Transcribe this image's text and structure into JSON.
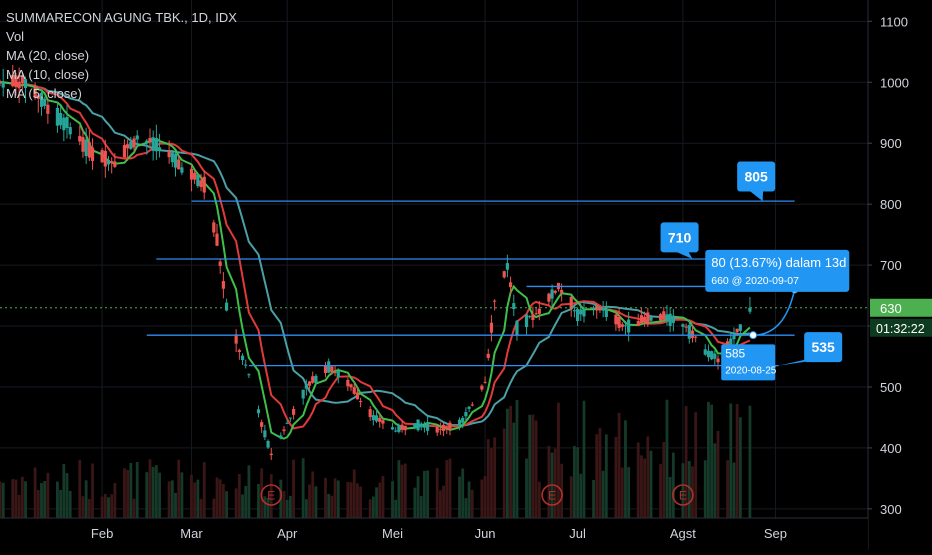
{
  "header": {
    "symbol_title": "SUMMARECON AGUNG TBK., 1D, IDX",
    "indicators": [
      "Vol",
      "MA (20, close)",
      "MA (10, close)",
      "MA (5, close)"
    ]
  },
  "colors": {
    "background": "#000000",
    "up": "#26a69a",
    "down": "#ef5350",
    "ma20": "#4b9fa6",
    "ma10": "#e03a3a",
    "ma5": "#3fbf4a",
    "hline": "#2f8cf0",
    "label_bg": "#2196f3",
    "price_line": "#4caf50",
    "earnings": "#b0302c",
    "axis_text": "#d1d4dc"
  },
  "chart_data": {
    "type": "candlestick",
    "ylim": [
      285,
      1135
    ],
    "y_ticks": [
      300,
      400,
      500,
      600,
      700,
      800,
      900,
      1000,
      1100
    ],
    "x_ticks": [
      {
        "label": "Feb",
        "date": "2020-02-03"
      },
      {
        "label": "Mar",
        "date": "2020-03-02"
      },
      {
        "label": "Apr",
        "date": "2020-04-01"
      },
      {
        "label": "Mei",
        "date": "2020-05-04"
      },
      {
        "label": "Jun",
        "date": "2020-06-02"
      },
      {
        "label": "Jul",
        "date": "2020-07-01"
      },
      {
        "label": "Agst",
        "date": "2020-08-03"
      },
      {
        "label": "Sep",
        "date": "2020-09-01"
      }
    ],
    "x_range": [
      "2020-01-02",
      "2020-09-30"
    ],
    "ohlc_anchors": [
      {
        "date": "2020-01-02",
        "close": 1000
      },
      {
        "date": "2020-01-10",
        "close": 1000
      },
      {
        "date": "2020-01-17",
        "close": 960
      },
      {
        "date": "2020-01-24",
        "close": 925
      },
      {
        "date": "2020-01-31",
        "close": 880
      },
      {
        "date": "2020-02-07",
        "close": 870
      },
      {
        "date": "2020-02-14",
        "close": 910
      },
      {
        "date": "2020-02-21",
        "close": 895
      },
      {
        "date": "2020-02-28",
        "close": 860
      },
      {
        "date": "2020-03-06",
        "close": 830
      },
      {
        "date": "2020-03-10",
        "close": 740
      },
      {
        "date": "2020-03-13",
        "close": 630
      },
      {
        "date": "2020-03-17",
        "close": 560
      },
      {
        "date": "2020-03-20",
        "close": 520
      },
      {
        "date": "2020-03-24",
        "close": 440
      },
      {
        "date": "2020-03-27",
        "close": 390
      },
      {
        "date": "2020-04-01",
        "close": 440
      },
      {
        "date": "2020-04-07",
        "close": 500
      },
      {
        "date": "2020-04-14",
        "close": 535
      },
      {
        "date": "2020-04-21",
        "close": 500
      },
      {
        "date": "2020-04-28",
        "close": 450
      },
      {
        "date": "2020-05-05",
        "close": 430
      },
      {
        "date": "2020-05-12",
        "close": 440
      },
      {
        "date": "2020-05-19",
        "close": 430
      },
      {
        "date": "2020-05-26",
        "close": 445
      },
      {
        "date": "2020-06-02",
        "close": 510
      },
      {
        "date": "2020-06-05",
        "close": 640
      },
      {
        "date": "2020-06-09",
        "close": 700
      },
      {
        "date": "2020-06-12",
        "close": 600
      },
      {
        "date": "2020-06-18",
        "close": 620
      },
      {
        "date": "2020-06-25",
        "close": 665
      },
      {
        "date": "2020-07-01",
        "close": 620
      },
      {
        "date": "2020-07-08",
        "close": 630
      },
      {
        "date": "2020-07-15",
        "close": 600
      },
      {
        "date": "2020-07-22",
        "close": 610
      },
      {
        "date": "2020-07-29",
        "close": 615
      },
      {
        "date": "2020-08-04",
        "close": 600
      },
      {
        "date": "2020-08-10",
        "close": 560
      },
      {
        "date": "2020-08-14",
        "close": 545
      },
      {
        "date": "2020-08-19",
        "close": 580
      },
      {
        "date": "2020-08-24",
        "close": 630
      }
    ],
    "horizontal_levels": [
      {
        "price": 805,
        "label": "805",
        "from": "2020-03-02",
        "to": "2020-09-07"
      },
      {
        "price": 710,
        "label": "710",
        "from": "2020-02-20",
        "to": "2020-08-20"
      },
      {
        "price": 665,
        "label": "",
        "from": "2020-06-15",
        "to": "2020-09-11"
      },
      {
        "price": 585,
        "label": "",
        "from": "2020-02-17",
        "to": "2020-09-07"
      },
      {
        "price": 535,
        "label": "535",
        "from": "2020-03-20",
        "to": "2020-09-02"
      }
    ],
    "price_line": 630,
    "price_label": "630",
    "countdown": "01:32:22",
    "earnings_dates": [
      "2020-03-27",
      "2020-06-23",
      "2020-08-03"
    ],
    "earnings_label": "E",
    "projection": {
      "from_date": "2020-08-25",
      "from_price": 585,
      "to_date": "2020-09-07",
      "to_price": 660,
      "text_main": "80 (13.67%) dalam 13d",
      "text_sub": "660 @ 2020-09-07",
      "start_label": "585",
      "start_date_label": "2020-08-25"
    }
  }
}
